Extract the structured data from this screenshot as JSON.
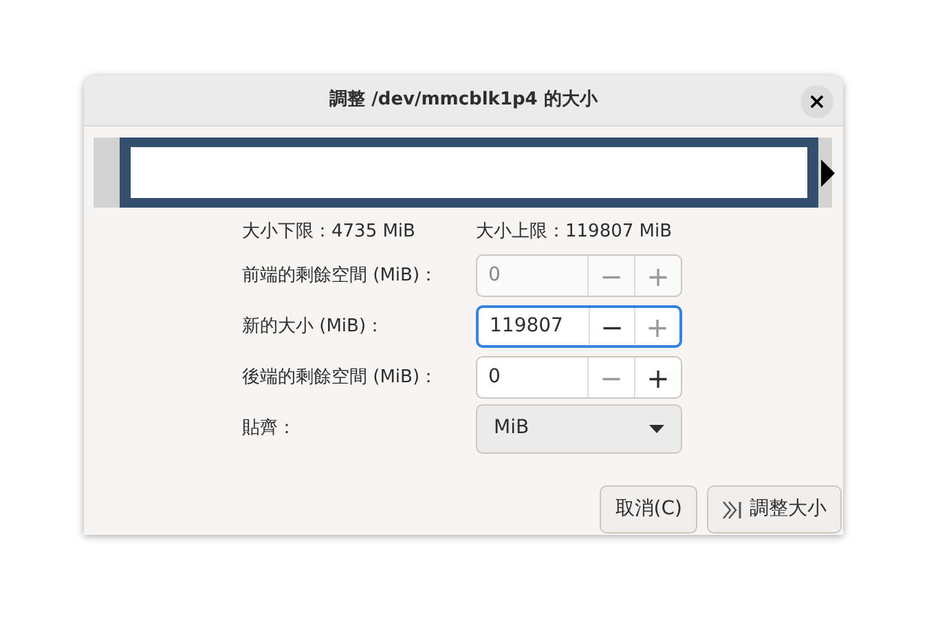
{
  "window": {
    "title": "調整 /dev/mmcblk1p4 的大小",
    "close": "×"
  },
  "limits": {
    "min": "大小下限：4735 MiB",
    "max": "大小上限：119807 MiB"
  },
  "rows": [
    {
      "kind": "spin",
      "label": "前端的剩餘空間 (MiB)：",
      "value": "0",
      "disabled": true,
      "focused": false,
      "minus": "−",
      "plus": "+",
      "minus_disabled": true,
      "plus_disabled": true
    },
    {
      "kind": "spin",
      "label": "新的大小 (MiB)：",
      "value": "119807",
      "disabled": false,
      "focused": true,
      "minus": "−",
      "plus": "+",
      "minus_disabled": false,
      "plus_disabled": true
    },
    {
      "kind": "spin",
      "label": "後端的剩餘空間 (MiB)：",
      "value": "0",
      "disabled": false,
      "focused": false,
      "minus": "−",
      "plus": "+",
      "minus_disabled": true,
      "plus_disabled": false
    },
    {
      "kind": "combo",
      "label": "貼齊：",
      "value": "MiB"
    }
  ],
  "buttons": [
    {
      "label": "取消(C)",
      "kind": "plain"
    },
    {
      "label": "調整大小",
      "kind": "icon"
    }
  ]
}
